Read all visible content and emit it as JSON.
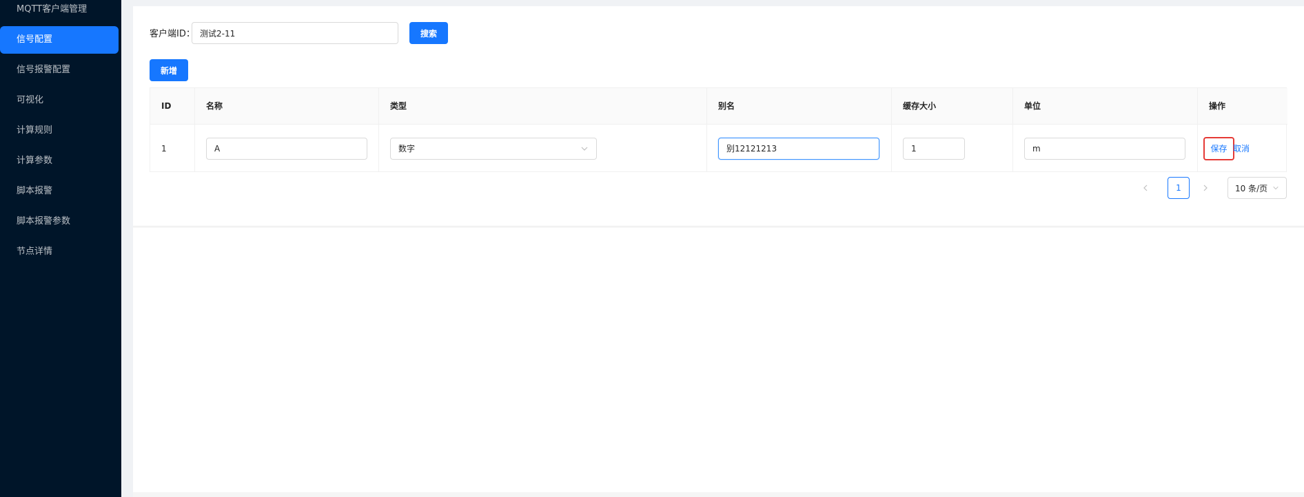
{
  "sidebar": {
    "items": [
      {
        "label": "MQTT客户端管理"
      },
      {
        "label": "信号配置"
      },
      {
        "label": "信号报警配置"
      },
      {
        "label": "可视化"
      },
      {
        "label": "计算规则"
      },
      {
        "label": "计算参数"
      },
      {
        "label": "脚本报警"
      },
      {
        "label": "脚本报警参数"
      },
      {
        "label": "节点详情"
      }
    ],
    "active": "信号配置",
    "active_color": "#1677ff",
    "bg_color": "#001529"
  },
  "search": {
    "label": "客户端ID：",
    "value": "测试2-11",
    "button": "搜索"
  },
  "toolbar": {
    "add_label": "新增"
  },
  "table": {
    "headers": [
      "ID",
      "名称",
      "类型",
      "别名",
      "缓存大小",
      "单位",
      "操作"
    ],
    "row": {
      "id": "1",
      "name": "A",
      "type": "数字",
      "alias": "别12121213",
      "cache_size": "1",
      "unit": "m",
      "save": "保存",
      "cancel": "取消"
    }
  },
  "pagination": {
    "current": "1",
    "page_size": "10 条/页"
  },
  "icons": {
    "prev": "chevron-left-icon",
    "next": "chevron-right-icon",
    "dropdown": "chevron-down-icon"
  },
  "highlight_color": "#e53935"
}
